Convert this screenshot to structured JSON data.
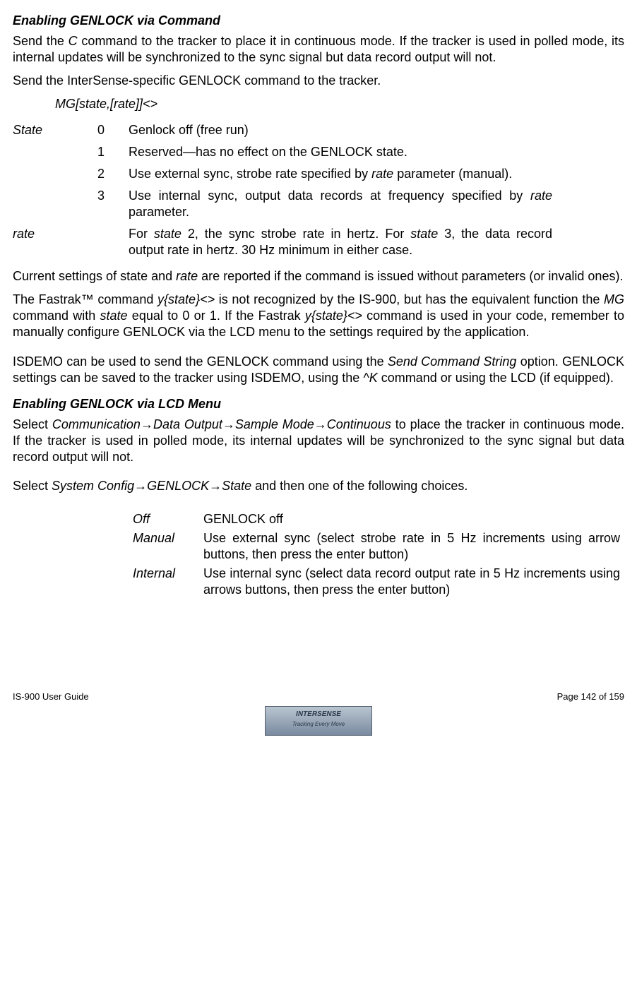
{
  "section1": {
    "title": "Enabling GENLOCK via Command",
    "p1a": "Send the ",
    "p1b": "C",
    "p1c": " command to the tracker to place it in continuous mode.  If the tracker is used in polled mode, its internal updates will be synchronized to the sync signal but data record output will not.",
    "p2": "Send the InterSense-specific GENLOCK command to the tracker.",
    "cmd": "MG[state,[rate]]<>",
    "state_label": "State",
    "rows": [
      {
        "k": "0",
        "d": "Genlock off (free run)"
      },
      {
        "k": "1",
        "d": "Reserved—has no effect on the GENLOCK state."
      },
      {
        "k": "2",
        "d_a": "Use external sync, strobe rate specified by ",
        "d_i": "rate",
        "d_b": " parameter (manual)."
      },
      {
        "k": "3",
        "d_a": "Use internal sync, output data records at frequency specified by ",
        "d_i": "rate",
        "d_b": " parameter."
      }
    ],
    "rate_label": "rate",
    "rate_a": "For ",
    "rate_i1": "state",
    "rate_b": " 2, the sync strobe rate in hertz.  For ",
    "rate_i2": "state",
    "rate_c": " 3, the data record output rate in hertz.  30 Hz minimum in either case.",
    "p3a": "Current settings of state and ",
    "p3i": "rate",
    "p3b": " are reported if the command is issued without parameters (or invalid ones).",
    "p4parts": {
      "a": "The Fastrak™ command ",
      "i1": "y{state}<>",
      "b": " is not recognized by the IS-900, but has the equivalent function the ",
      "i2": "MG",
      "c": " command with ",
      "i3": "state",
      "d": " equal to 0 or 1.  If the Fastrak ",
      "i4": "y{state}<>",
      "e": " command is used in your code, remember to manually configure GENLOCK via the LCD menu to the settings required by the application."
    },
    "p5parts": {
      "a": "ISDEMO can be used to send the GENLOCK command using the ",
      "i1": "Send Command String",
      "b": " option.  GENLOCK settings can be saved to the tracker using ISDEMO, using the ",
      "i2": "^K",
      "c": " command or using the LCD (if equipped)."
    }
  },
  "section2": {
    "title": "Enabling GENLOCK via LCD Menu",
    "p1a": "Select ",
    "p1i": "Communication→Data Output→Sample Mode→Continuous",
    "p1b": " to place the tracker in continuous mode.  If the tracker is used in polled mode, its internal updates will be synchronized to the sync signal but data record output will not.",
    "p2a": "Select ",
    "p2i": "System Config→GENLOCK→State",
    "p2b": " and then one of the following choices.",
    "menu": [
      {
        "l": "Off",
        "d": "GENLOCK off"
      },
      {
        "l": "Manual",
        "d": "Use external sync (select strobe rate in 5 Hz increments using arrow buttons, then press the enter button)"
      },
      {
        "l": "Internal",
        "d": "Use internal sync (select data record output rate in 5 Hz increments using arrows buttons, then press the enter button)"
      }
    ]
  },
  "footer": {
    "left": "IS-900 User Guide",
    "right": "Page 142 of 159",
    "logo_main": "INTERSENSE",
    "logo_sub": "Tracking Every Move"
  }
}
